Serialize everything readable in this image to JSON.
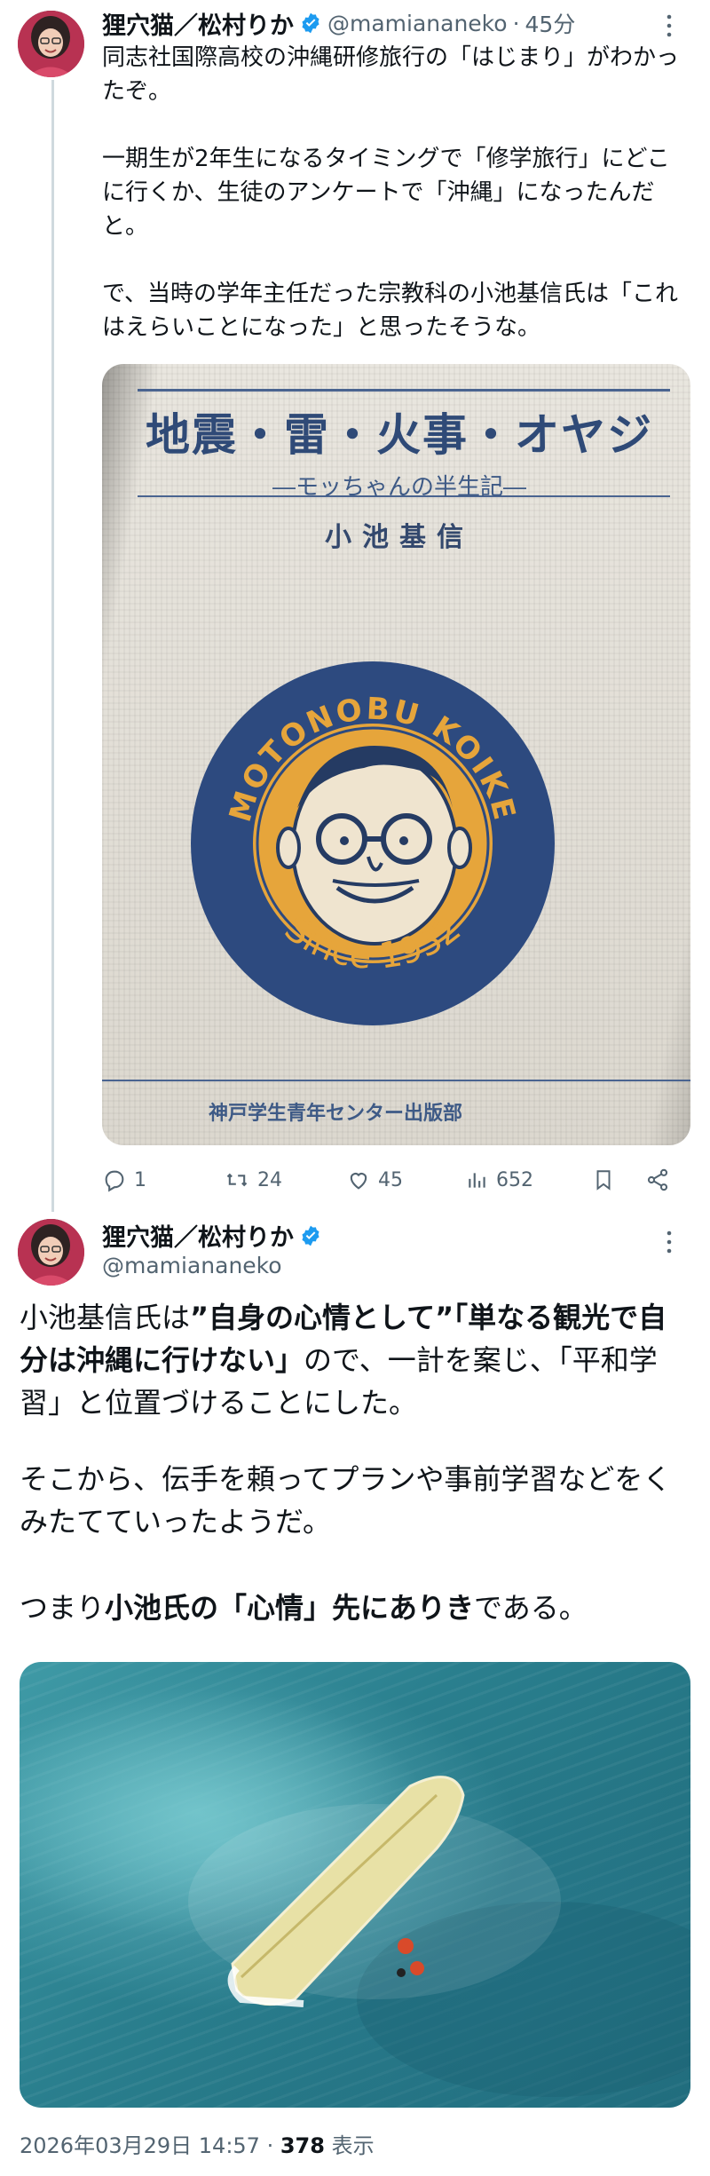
{
  "tweet1": {
    "display_name": "狸穴猫／松村りか",
    "handle": "@mamiananeko",
    "time": "45分",
    "text": "同志社国際高校の沖縄研修旅行の「はじまり」がわかったぞ。\n\n一期生が2年生になるタイミングで「修学旅行」にどこに行くか、生徒のアンケートで「沖縄」になったんだと。\n\nで、当時の学年主任だった宗教科の小池基信氏は「これはえらいことになった」と思ったそうな。",
    "image": {
      "title": "地震・雷・火事・オヤジ",
      "subtitle": "―モッちゃんの半生記―",
      "author": "小池基信",
      "emblem_top": "MOTONOBU KOIKE",
      "emblem_bottom": "Since 1932",
      "publisher": "神戸学生青年センター出版部"
    },
    "actions": {
      "replies": "1",
      "retweets": "24",
      "likes": "45",
      "views": "652"
    }
  },
  "tweet2": {
    "display_name": "狸穴猫／松村りか",
    "handle": "@mamiananeko",
    "p1a": "小池基信氏は",
    "p1b": "”自身の心情として”「単なる観光で自分は沖縄に行けない」",
    "p1c": "ので、一計を案じ、「平和学習」と位置づけることにした。",
    "p2": "そこから、伝手を頼ってプランや事前学習などをくみたてていったようだ。",
    "p3a": "つまり",
    "p3b": "小池氏の「心情」先にありき",
    "p3c": "である。",
    "timestamp": "2026年03月29日 14:57",
    "views_count": "378",
    "views_label": "表示"
  },
  "colors": {
    "verified": "#1d9bf0",
    "muted": "#536471",
    "text": "#0f1419"
  }
}
